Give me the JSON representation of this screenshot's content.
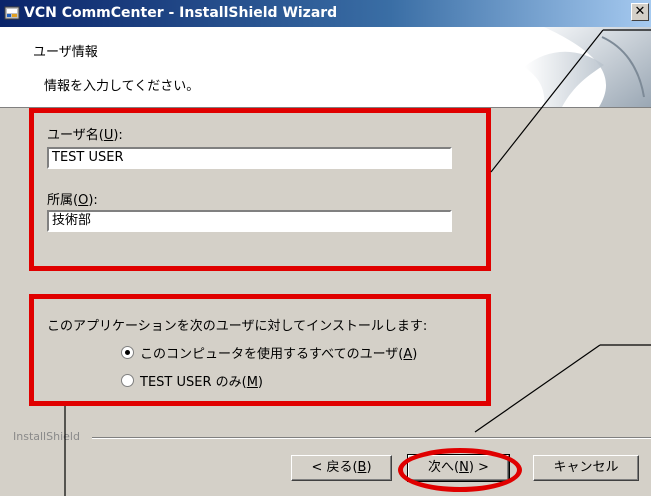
{
  "window": {
    "title": "VCN CommCenter - InstallShield Wizard",
    "close_glyph": "✕"
  },
  "header": {
    "title": "ユーザ情報",
    "subtitle": "情報を入力してください。"
  },
  "form": {
    "user_name": {
      "label_prefix": "ユーザ名(",
      "accel": "U",
      "label_suffix": "):",
      "value": "TEST USER"
    },
    "organization": {
      "label_prefix": "所属(",
      "accel": "O",
      "label_suffix": "):",
      "value": "技術部"
    }
  },
  "install_for": {
    "prompt": "このアプリケーションを次のユーザに対してインストールします:",
    "options": [
      {
        "prefix": "このコンピュータを使用するすべてのユーザ(",
        "accel": "A",
        "suffix": ")",
        "checked": true
      },
      {
        "prefix": "TEST USER のみ(",
        "accel": "M",
        "suffix": ")",
        "checked": false
      }
    ]
  },
  "footer": {
    "brand": "InstallShield",
    "back": {
      "prefix": "< 戻る(",
      "accel": "B",
      "suffix": ")"
    },
    "next": {
      "prefix": "次へ(",
      "accel": "N",
      "suffix": ") >"
    },
    "cancel": "キャンセル"
  },
  "colors": {
    "annotation": "#e00000",
    "title_bar_start": "#0a246a",
    "dialog_face": "#d4d0c8"
  },
  "icons": [
    "installer-icon",
    "close-icon",
    "header-graphic"
  ]
}
